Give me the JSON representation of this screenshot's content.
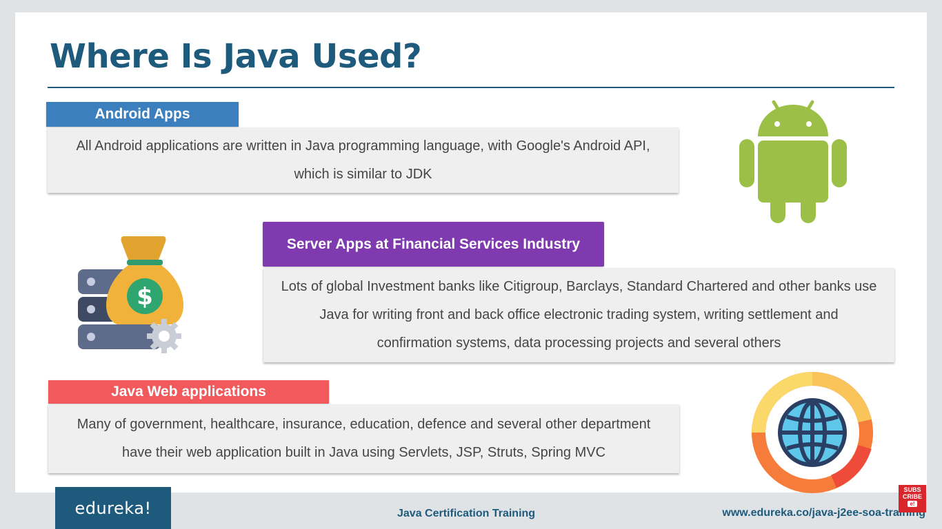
{
  "slide": {
    "title": "Where Is Java Used?"
  },
  "sections": {
    "android": {
      "label": "Android Apps",
      "lines": [
        "All Android applications are written in Java programming language, with Google's Android API,",
        "which is similar to JDK"
      ],
      "icon": "android-robot-icon",
      "color": "#3c7fbe"
    },
    "server": {
      "label": "Server Apps at Financial Services Industry",
      "lines": [
        "Lots of global Investment banks like Citigroup, Barclays, Standard Chartered and other banks use",
        "Java for writing front and back office electronic trading system, writing settlement and",
        "confirmation systems, data processing projects and several others"
      ],
      "icon": "money-bag-server-icon",
      "color": "#7e3aae"
    },
    "web": {
      "label": "Java Web applications",
      "lines": [
        "Many of government, healthcare, insurance, education, defence and several other department",
        "have their web application built in Java using Servlets, JSP, Struts, Spring MVC"
      ],
      "icon": "globe-icon",
      "color": "#f2595d"
    }
  },
  "footer": {
    "logo": "edureka!",
    "center_text": "Java Certification Training",
    "url": "www.edureka.co/java-j2ee-soa-training",
    "subscribe_line1": "SUBS",
    "subscribe_line2": "CRIBE",
    "subscribe_play": "e!"
  },
  "colors": {
    "title": "#1d5a7c",
    "android_green": "#9cc047",
    "card_bg": "#efefef"
  }
}
